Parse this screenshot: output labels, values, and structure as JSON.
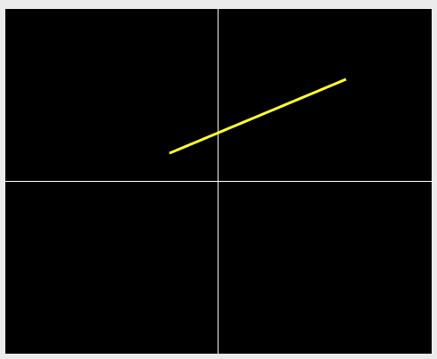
{
  "colors": {
    "window_background": "#ebebeb",
    "plot_background": "#000000",
    "axis": "#ffffff",
    "line": "#ffff2e"
  },
  "plot": {
    "axes_visible": true,
    "segment": {
      "start": [
        -0.225,
        0.155
      ],
      "end": [
        0.6,
        0.57
      ]
    }
  }
}
